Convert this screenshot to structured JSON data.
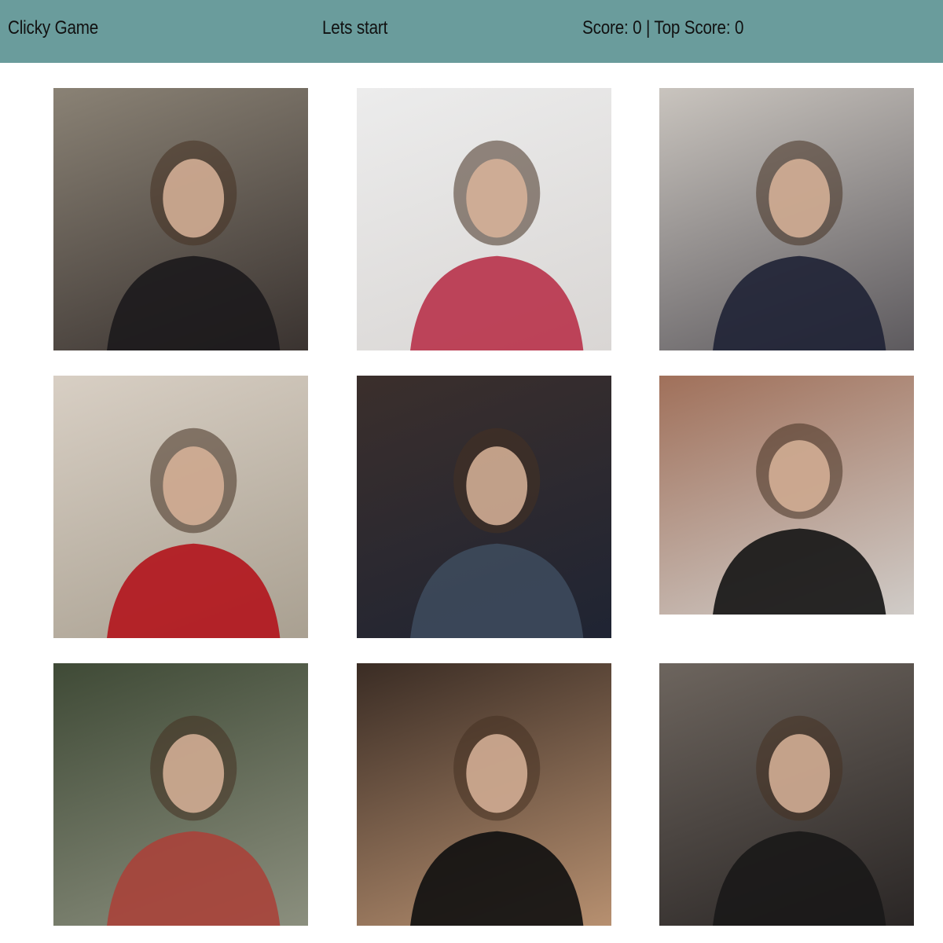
{
  "navbar": {
    "brand": "Clicky Game",
    "message": "Lets start",
    "score_text": "Score: 0 | Top Score: 0"
  },
  "game": {
    "score": 0,
    "top_score": 0
  },
  "cards": [
    {
      "name": "card-woman-holding-camera",
      "bg": [
        "#8a8275",
        "#3a3330"
      ],
      "accent": "#1c1a1c"
    },
    {
      "name": "card-woman-short-blonde-hair",
      "bg": [
        "#ececec",
        "#d9d6d4"
      ],
      "accent": "#b8324a"
    },
    {
      "name": "card-couple-smiling",
      "bg": [
        "#c9c4be",
        "#5d5a5e"
      ],
      "accent": "#1f2235"
    },
    {
      "name": "card-woman-by-mailbox",
      "bg": [
        "#d8cfc4",
        "#a9a091"
      ],
      "accent": "#b2141c"
    },
    {
      "name": "card-woman-on-sofa",
      "bg": [
        "#3b2f2c",
        "#1f2433"
      ],
      "accent": "#3d4a5c"
    },
    {
      "name": "card-smiling-man",
      "bg": [
        "#a0705a",
        "#d0ccc8"
      ],
      "accent": "#141414"
    },
    {
      "name": "card-pirate",
      "bg": [
        "#3f4a36",
        "#8b8f7e"
      ],
      "accent": "#a8433a"
    },
    {
      "name": "card-woman-patterned-jacket",
      "bg": [
        "#3a2c24",
        "#b79070"
      ],
      "accent": "#101010"
    },
    {
      "name": "card-woman-with-glasses",
      "bg": [
        "#6d655e",
        "#2a2625"
      ],
      "accent": "#1a1818"
    }
  ]
}
